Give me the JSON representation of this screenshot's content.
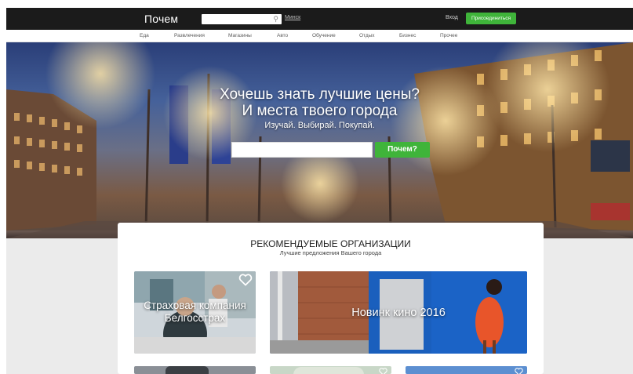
{
  "header": {
    "logo": "Почем",
    "search_placeholder": "",
    "city_link": "Минск",
    "login_label": "Вход",
    "join_label": "Присоединиться"
  },
  "categories": [
    "Еда",
    "Развлечения",
    "Магазины",
    "Авто",
    "Обучение",
    "Отдых",
    "Бизнес",
    "Прочее"
  ],
  "hero": {
    "title_line1": "Хочешь знать лучшие цены?",
    "title_line2": "И места твоего города",
    "subtitle": "Изучай. Выбирай. Покупай.",
    "search_placeholder": "",
    "search_button": "Почем?"
  },
  "recommended": {
    "title": "РЕКОМЕНДУЕМЫЕ ОРГАНИЗАЦИИ",
    "subtitle": "Лучшие предложения Вашего города",
    "cards": [
      {
        "title": "Страховая компания Белгосстрах"
      },
      {
        "title": "Новинк кино 2016"
      }
    ]
  },
  "colors": {
    "topbar": "#1b1b1b",
    "accent_green": "#3fb43a",
    "page_bg": "#ebebeb"
  },
  "icons": [
    "search-icon",
    "heart-icon"
  ]
}
